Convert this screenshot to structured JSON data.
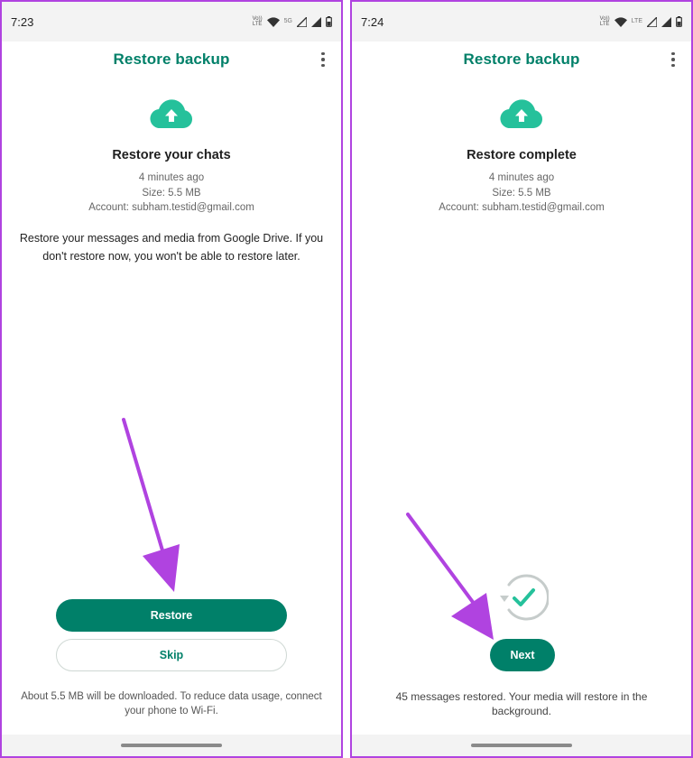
{
  "left": {
    "status": {
      "time": "7:23",
      "volte": "Vo))",
      "volte_sub": "LTE",
      "network": "5G"
    },
    "app_bar": {
      "title": "Restore backup"
    },
    "heading": "Restore your chats",
    "backup_age": "4 minutes ago",
    "backup_size": "Size: 5.5 MB",
    "account": "Account: subham.testid@gmail.com",
    "description": "Restore your messages and media from Google Drive. If you don't restore now, you won't be able to restore later.",
    "restore_label": "Restore",
    "skip_label": "Skip",
    "footnote": "About 5.5 MB will be downloaded. To reduce data usage, connect your phone to Wi-Fi."
  },
  "right": {
    "status": {
      "time": "7:24",
      "volte": "Vo))",
      "volte_sub": "LTE",
      "network": "LTE"
    },
    "app_bar": {
      "title": "Restore backup"
    },
    "heading": "Restore complete",
    "backup_age": "4 minutes ago",
    "backup_size": "Size: 5.5 MB",
    "account": "Account: subham.testid@gmail.com",
    "next_label": "Next",
    "restored_note": "45 messages restored. Your media will restore in the background."
  },
  "colors": {
    "brand": "#008069",
    "accent_icon": "#25c19b",
    "annotation_arrow": "#b043e0",
    "frame": "#b043e0"
  },
  "icons": {
    "cloud": "cloud-upload-icon",
    "menu": "more-vert-icon",
    "done": "restore-complete-icon",
    "wifi": "wifi-icon",
    "signal": "signal-icon",
    "battery": "battery-icon"
  }
}
